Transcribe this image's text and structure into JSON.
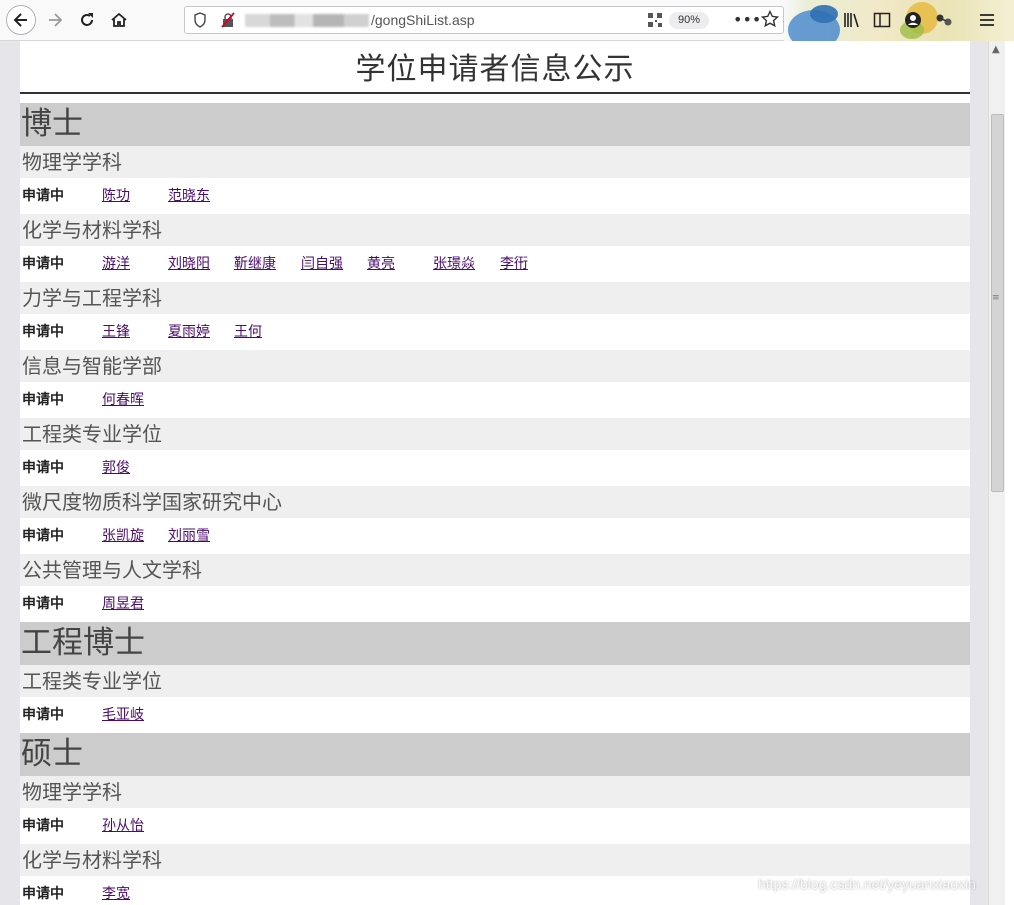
{
  "browser": {
    "url_suffix": "/gongShiList.asp",
    "zoom": "90%"
  },
  "page": {
    "title": "学位申请者信息公示",
    "status_label": "申请中"
  },
  "sections": [
    {
      "degree": "博士",
      "subjects": [
        {
          "name": "物理学学科",
          "names": [
            "陈功",
            "范晓东"
          ]
        },
        {
          "name": "化学与材料学科",
          "names": [
            "游洋",
            "刘晓阳",
            "靳继康",
            "闫自强",
            "黄亮",
            "张璟焱",
            "李衎"
          ]
        },
        {
          "name": "力学与工程学科",
          "names": [
            "王锋",
            "夏雨婷",
            "王何"
          ]
        },
        {
          "name": "信息与智能学部",
          "names": [
            "何春晖"
          ]
        },
        {
          "name": "工程类专业学位",
          "names": [
            "郭俊"
          ]
        },
        {
          "name": "微尺度物质科学国家研究中心",
          "names": [
            "张凯旋",
            "刘丽雪"
          ]
        },
        {
          "name": "公共管理与人文学科",
          "names": [
            "周昱君"
          ]
        }
      ]
    },
    {
      "degree": "工程博士",
      "subjects": [
        {
          "name": "工程类专业学位",
          "names": [
            "毛亚岐"
          ]
        }
      ]
    },
    {
      "degree": "硕士",
      "subjects": [
        {
          "name": "物理学学科",
          "names": [
            "孙从怡"
          ]
        },
        {
          "name": "化学与材料学科",
          "names": [
            "李宽"
          ]
        }
      ]
    }
  ],
  "watermark": "https://blog.csdn.net/yeyuanxiaoxin"
}
